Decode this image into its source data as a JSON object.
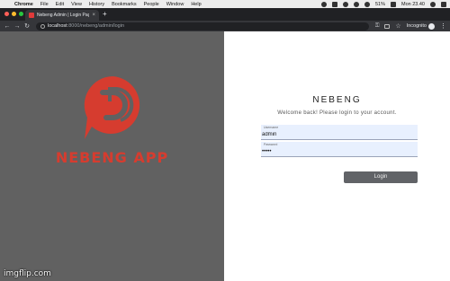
{
  "menubar": {
    "app": "Chrome",
    "items": [
      "File",
      "Edit",
      "View",
      "History",
      "Bookmarks",
      "People",
      "Window",
      "Help"
    ],
    "battery": "51%",
    "clock": "Mon 23.40"
  },
  "browser": {
    "tab_title": "Nebeng Admin | Login Page",
    "url_host": "localhost",
    "url_path": ":8000/nebeng/admin/login",
    "profile": "Incognito"
  },
  "brand": {
    "name": "NEBENG APP",
    "color": "#d63c2f"
  },
  "login": {
    "title": "NEBENG",
    "welcome": "Welcome back! Please login to your account.",
    "username_label": "Username",
    "username_value": "admin",
    "password_label": "Password",
    "password_value": "•••••",
    "button": "Login"
  },
  "watermark": "imgflip.com",
  "colors": {
    "left_panel_bg": "#616161",
    "input_bg": "#e8f0fe",
    "button_bg": "#616367"
  }
}
